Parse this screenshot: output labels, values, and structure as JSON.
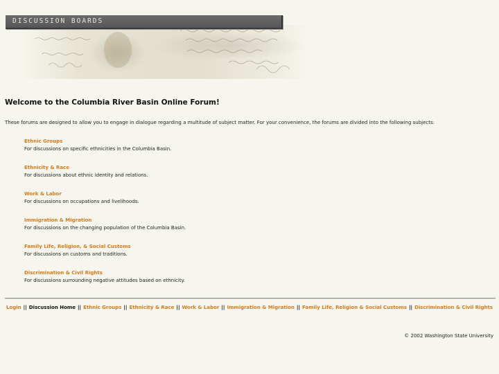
{
  "banner": {
    "title": "DISCUSSION BOARDS"
  },
  "main": {
    "heading": "Welcome to the Columbia River Basin Online Forum!",
    "intro": "These forums are designed to allow you to engage in dialogue regarding a multitude of subject matter. For your convenience, the forums are divided into the following subjects:",
    "topics": [
      {
        "title": "Ethnic Groups",
        "description": "For discussions on specific ethnicities in the Columbia Basin."
      },
      {
        "title": "Ethnicity & Race",
        "description": "For discussions about ethnic identity and relations."
      },
      {
        "title": "Work & Labor",
        "description": "For discussions on occupations and livelihoods."
      },
      {
        "title": "Immigration & Migration",
        "description": "For discussions on the changing population of the Columbia Basin."
      },
      {
        "title": "Family Life, Religion, & Social Customs",
        "description": "For discussions on customs and traditions."
      },
      {
        "title": "Discrimination & Civil Rights",
        "description": "For discussions surrounding negative attitudes based on ethnicity."
      }
    ]
  },
  "footer": {
    "separator": "||",
    "nav": [
      "Login",
      "Discussion Home",
      "Ethnic Groups",
      "Ethnicity & Race",
      "Work & Labor",
      "Immigration & Migration",
      "Family Life, Religion & Social Customs",
      "Discrimination & Civil Rights"
    ],
    "copyright": "© 2002 Washington State University"
  },
  "colors": {
    "background": "#f6f6ee",
    "link": "#d67a1c",
    "banner_bar": "#5f5f5f"
  }
}
